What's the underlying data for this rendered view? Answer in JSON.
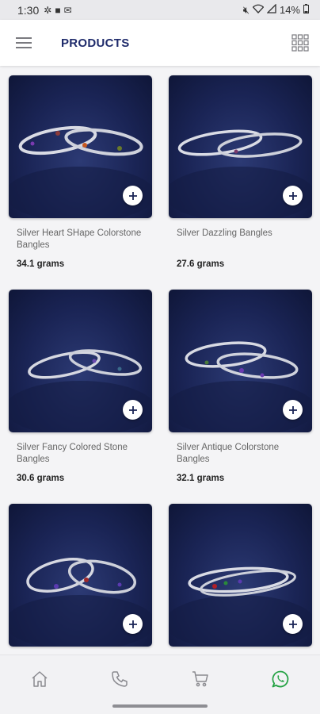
{
  "status_bar": {
    "time": "1:30",
    "battery": "14%"
  },
  "header": {
    "title": "PRODUCTS",
    "menu_icon": "hamburger-menu-icon",
    "view_icon": "grid-view-icon"
  },
  "products": [
    {
      "name": "Silver Heart SHape Colorstone Bangles",
      "weight": "34.1 grams"
    },
    {
      "name": "Silver Dazzling Bangles",
      "weight": "27.6 grams"
    },
    {
      "name": "Silver Fancy Colored Stone Bangles",
      "weight": "30.6 grams"
    },
    {
      "name": "Silver Antique Colorstone Bangles",
      "weight": "32.1 grams"
    },
    {
      "name": "",
      "weight": ""
    },
    {
      "name": "",
      "weight": ""
    }
  ],
  "bottom_nav": {
    "items": [
      "home-icon",
      "phone-icon",
      "cart-icon",
      "whatsapp-icon"
    ],
    "whatsapp_color": "#25a244",
    "icon_color": "#8a8a8f"
  },
  "colors": {
    "title": "#1f2b6b",
    "image_bg": "#1a2455"
  }
}
